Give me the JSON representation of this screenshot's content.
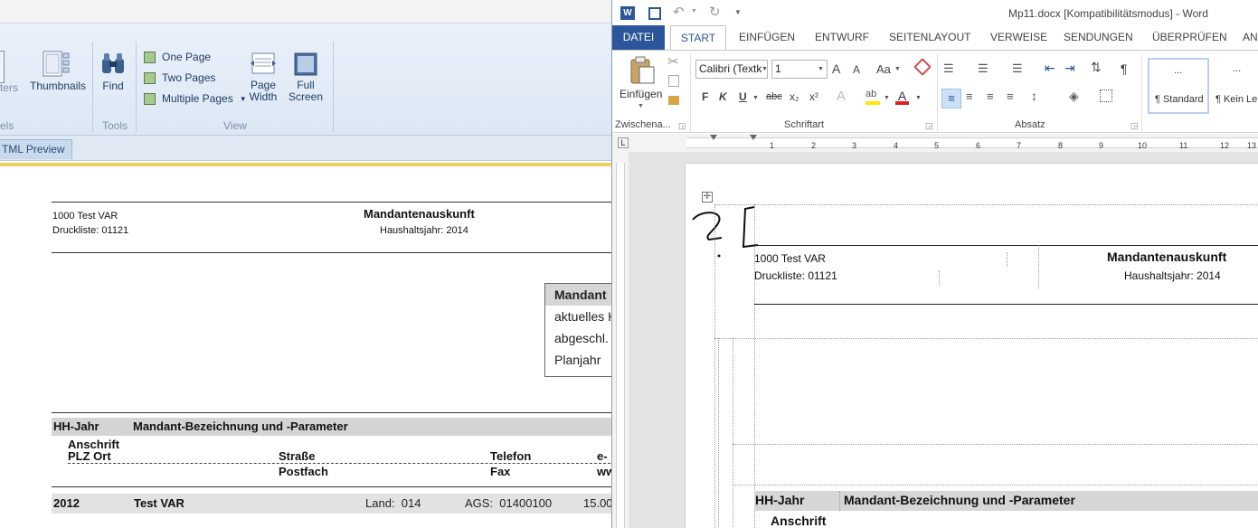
{
  "left_window": {
    "ribbon": {
      "partial_button_label": "ters",
      "thumbnails_label": "Thumbnails",
      "find_label": "Find",
      "one_page_label": "One Page",
      "two_pages_label": "Two Pages",
      "multiple_pages_label": "Multiple Pages",
      "page_width_label": "Page\nWidth",
      "full_screen_label": "Full\nScreen",
      "group_partial_label": "els",
      "group_tools_label": "Tools",
      "group_view_label": "View"
    },
    "tab_label": "TML Preview",
    "report": {
      "client_line": "1000 Test VAR",
      "print_list": "Druckliste: 01121",
      "title": "Mandantenauskunft",
      "budget_year": "Haushaltsjahr: 2014",
      "infobox": {
        "head": "Mandant",
        "rows": [
          "aktuelles H",
          "abgeschl.",
          "Planjahr"
        ]
      },
      "table_header": {
        "col_year": "HH-Jahr",
        "col_desc": "Mandant-Bezeichnung und -Parameter",
        "address": "Anschrift",
        "plz_ort": "PLZ Ort",
        "street": "Straße",
        "pobox": "Postfach",
        "phone": "Telefon",
        "fax": "Fax",
        "email": "e-",
        "www": "ww"
      },
      "data_row": {
        "year": "2012",
        "name": "Test VAR",
        "land": "Land:  014",
        "ags": "AGS:  01400100",
        "extra": "15.00"
      }
    }
  },
  "word_window": {
    "title": "Mp11.docx [Kompatibilitätsmodus] - Word",
    "tabs": [
      "DATEI",
      "START",
      "EINFÜGEN",
      "ENTWURF",
      "SEITENLAYOUT",
      "VERWEISE",
      "SENDUNGEN",
      "ÜBERPRÜFEN",
      "AN"
    ],
    "ribbon": {
      "paste_label": "Einfügen",
      "clipboard_label": "Zwischena...",
      "font_name": "Calibri (Textk",
      "font_size": "1",
      "font_group_label": "Schriftart",
      "paragraph_group_label": "Absatz",
      "style_standard": "¶ Standard",
      "style_no_space": "¶ Kein Le",
      "style_preview": "...",
      "bold": "F",
      "italic": "K",
      "underline": "U",
      "strike": "abc",
      "subscript": "x₂",
      "superscript": "x²",
      "pilcrow": "¶",
      "grow_font": "A",
      "shrink_font": "A",
      "case": "Aa"
    },
    "ruler_numbers": [
      "1",
      "2",
      "3",
      "4",
      "5",
      "6",
      "7",
      "8",
      "9",
      "10",
      "11",
      "12",
      "13"
    ],
    "document": {
      "client_line": "1000 Test VAR",
      "print_list": "Druckliste: 01121",
      "title": "Mandantenauskunft",
      "budget_year": "Haushaltsjahr: 2014",
      "col_year": "HH-Jahr",
      "col_desc": "Mandant-Bezeichnung und -Parameter",
      "address": "Anschrift"
    }
  },
  "colors": {
    "word_blue": "#2b579a",
    "ribbon_blue": "#dde8f5",
    "accent_yellow": "#f0d060"
  }
}
